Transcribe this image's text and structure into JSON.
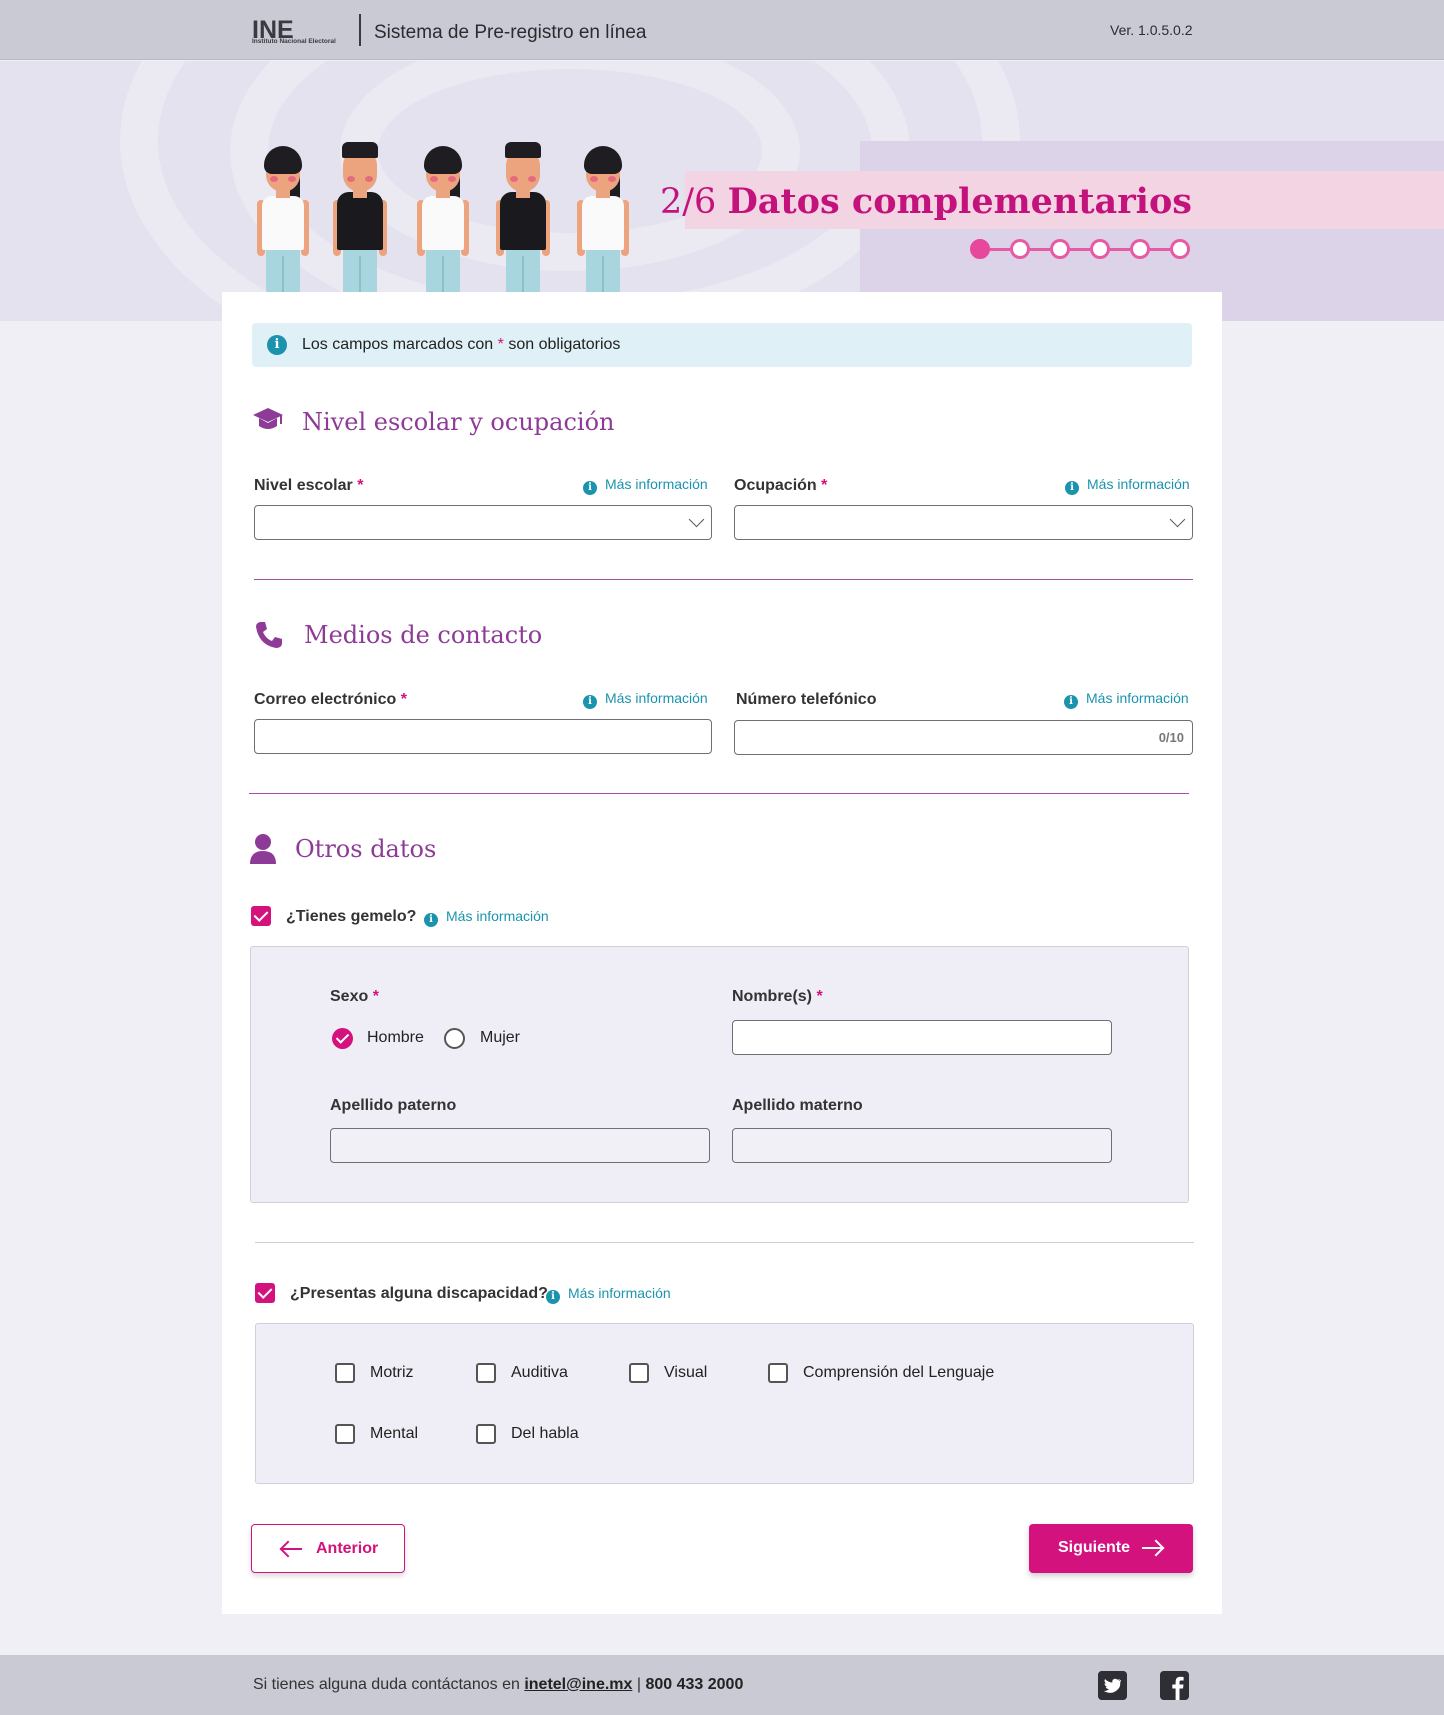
{
  "header": {
    "logo_text": "INE",
    "logo_subtitle": "Instituto Nacional Electoral",
    "system_title": "Sistema de Pre-registro en línea",
    "version": "Ver. 1.0.5.0.2"
  },
  "step": {
    "counter": "2/6",
    "title": "Datos complementarios",
    "current": 1,
    "total": 6
  },
  "alert": {
    "text_before": "Los campos marcados con",
    "asterisk": "*",
    "text_after": "son obligatorios"
  },
  "more_info_label": "Más información",
  "required_mark": "*",
  "sections": {
    "education": {
      "title": "Nivel escolar y ocupación",
      "nivel_escolar_label": "Nivel escolar",
      "nivel_escolar_value": "",
      "ocupacion_label": "Ocupación",
      "ocupacion_value": ""
    },
    "contact": {
      "title": "Medios de contacto",
      "email_label": "Correo electrónico",
      "email_value": "",
      "phone_label": "Número telefónico",
      "phone_value": "",
      "phone_counter": "0/10"
    },
    "other": {
      "title": "Otros datos",
      "twin_question": "¿Tienes gemelo?",
      "twin_checked": true,
      "sexo_label": "Sexo",
      "sexo_options": [
        "Hombre",
        "Mujer"
      ],
      "sexo_selected": "Hombre",
      "nombre_label": "Nombre(s)",
      "nombre_value": "",
      "apellido_paterno_label": "Apellido paterno",
      "apellido_materno_label": "Apellido materno",
      "disability_question": "¿Presentas alguna discapacidad?",
      "disability_checked": true,
      "disabilities": [
        "Motriz",
        "Auditiva",
        "Visual",
        "Comprensión del Lenguaje",
        "Mental",
        "Del habla"
      ]
    }
  },
  "buttons": {
    "prev": "Anterior",
    "next": "Siguiente"
  },
  "footer": {
    "text": "Si tienes alguna duda contáctanos en",
    "email": "inetel@ine.mx",
    "separator": "|",
    "phone": "800 433 2000",
    "social": [
      "twitter-icon",
      "facebook-icon"
    ]
  },
  "colors": {
    "accent": "#d4127e",
    "section_title": "#8e3b98",
    "info": "#1b93ae",
    "header_bg": "#c9cad3"
  }
}
